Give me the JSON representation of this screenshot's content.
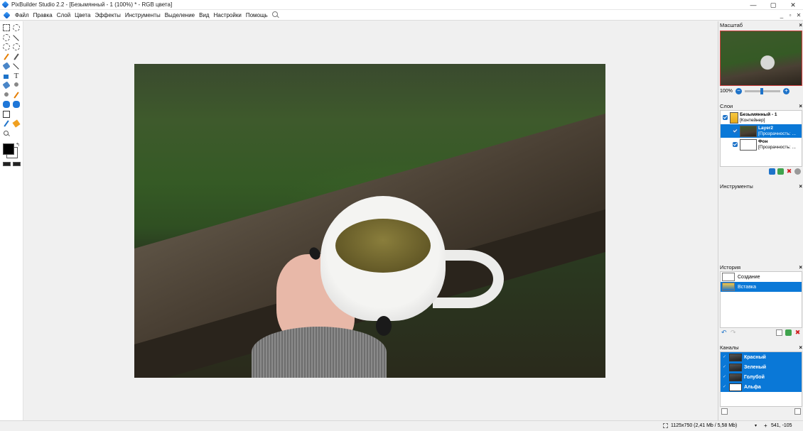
{
  "window": {
    "title": "PixBuilder Studio 2.2 - [Безымянный - 1 (100%) * - RGB цвета]",
    "controls": {
      "minimize": "—",
      "maximize": "▢",
      "close": "✕"
    }
  },
  "menu": {
    "items": [
      "Файл",
      "Правка",
      "Слой",
      "Цвета",
      "Эффекты",
      "Инструменты",
      "Выделение",
      "Вид",
      "Настройки",
      "Помощь"
    ],
    "mdi": {
      "minimize": "_",
      "restore": "▫",
      "close": "✕"
    }
  },
  "toolbox": {
    "fg_color": "#000000",
    "bg_color": "#ffffff"
  },
  "navigator": {
    "title": "Масштаб",
    "zoom_value": "100%",
    "zoom_out": "−",
    "zoom_in": "+",
    "close": "×"
  },
  "layers": {
    "title": "Слои",
    "close": "×",
    "items": [
      {
        "name": "Безымянный - 1",
        "desc": "[Контейнер]"
      },
      {
        "name": "Layer2",
        "desc": "[Прозрачность: ..."
      },
      {
        "name": "Фон",
        "desc": "[Прозрачность: ..."
      }
    ],
    "toolbar": {
      "delete": "✖"
    }
  },
  "instruments": {
    "title": "Инструменты",
    "close": "×"
  },
  "history": {
    "title": "История",
    "close": "×",
    "items": [
      "Создание",
      "Вставка"
    ],
    "toolbar": {
      "undo": "↶",
      "redo": "↷",
      "delete": "✖"
    }
  },
  "channels": {
    "title": "Каналы",
    "close": "×",
    "items": [
      "Красный",
      "Зеленый",
      "Голубой",
      "Альфа"
    ],
    "eye": "✓"
  },
  "status": {
    "size": "1125x750 (2,41 Mb / 5,58 Mb)",
    "coords": "541, -105",
    "dropdown": "▾",
    "cursor": "+"
  }
}
